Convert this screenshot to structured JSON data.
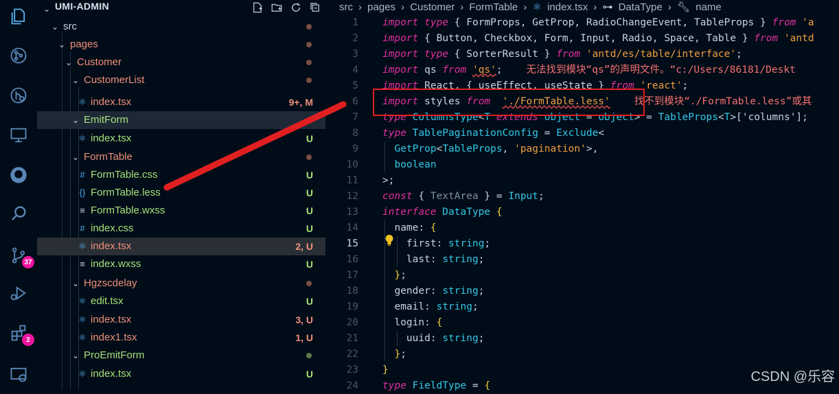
{
  "explorer": {
    "title": "UMI-ADMIN",
    "actions": [
      "new-file-icon",
      "new-folder-icon",
      "refresh-icon",
      "collapse-icon"
    ],
    "items": [
      {
        "label": "src",
        "type": "folder",
        "status": "",
        "color": "#c9d4e3"
      },
      {
        "label": "pages",
        "type": "folder",
        "status": "",
        "color": "#f0907a"
      },
      {
        "label": "Customer",
        "type": "folder",
        "status": "",
        "color": "#f0907a"
      },
      {
        "label": "CustomerList",
        "type": "folder",
        "status": "",
        "color": "#f0907a"
      },
      {
        "label": "index.tsx",
        "type": "react",
        "status": "9+, M",
        "color": "#f0907a"
      },
      {
        "label": "EmitForm",
        "type": "folder",
        "status": "",
        "color": "#a6e07a"
      },
      {
        "label": "index.tsx",
        "type": "react",
        "status": "U",
        "color": "#a6e07a"
      },
      {
        "label": "FormTable",
        "type": "folder",
        "status": "",
        "color": "#f0907a"
      },
      {
        "label": "FormTable.css",
        "type": "hash",
        "status": "U",
        "color": "#a6e07a"
      },
      {
        "label": "FormTable.less",
        "type": "braces",
        "status": "U",
        "color": "#a6e07a"
      },
      {
        "label": "FormTable.wxss",
        "type": "lines",
        "status": "U",
        "color": "#a6e07a"
      },
      {
        "label": "index.css",
        "type": "hash",
        "status": "U",
        "color": "#a6e07a"
      },
      {
        "label": "index.tsx",
        "type": "react",
        "status": "2, U",
        "color": "#f0907a"
      },
      {
        "label": "index.wxss",
        "type": "lines",
        "status": "U",
        "color": "#a6e07a"
      },
      {
        "label": "Hgzscdelay",
        "type": "folder",
        "status": "",
        "color": "#f0907a"
      },
      {
        "label": "edit.tsx",
        "type": "react",
        "status": "U",
        "color": "#a6e07a"
      },
      {
        "label": "index.tsx",
        "type": "react",
        "status": "3, U",
        "color": "#f0907a"
      },
      {
        "label": "index1.tsx",
        "type": "react",
        "status": "1, U",
        "color": "#f0907a"
      },
      {
        "label": "ProEmitForm",
        "type": "folder",
        "status": "",
        "color": "#a6e07a"
      },
      {
        "label": "index.tsx",
        "type": "react",
        "status": "U",
        "color": "#a6e07a"
      }
    ]
  },
  "activity_bar": {
    "icons": [
      "files-icon",
      "source-control-graph-icon",
      "git-history-icon",
      "remote-explorer-icon",
      "github-icon",
      "search-icon",
      "source-control-icon",
      "run-debug-icon",
      "extensions-icon",
      "remote-icon"
    ],
    "badges": {
      "source_control": "37",
      "extensions": "2"
    }
  },
  "breadcrumb": [
    "src",
    "pages",
    "Customer",
    "FormTable",
    "index.tsx",
    "DataType",
    "name"
  ],
  "editor": {
    "active_line": "15",
    "line_numbers": [
      "1",
      "2",
      "3",
      "4",
      "5",
      "6",
      "7",
      "8",
      "9",
      "10",
      "11",
      "12",
      "13",
      "14",
      "15",
      "16",
      "17",
      "18",
      "19",
      "20",
      "21",
      "22",
      "23",
      "24"
    ],
    "lines": [
      [
        [
          "kw",
          "import"
        ],
        [
          "id",
          " "
        ],
        [
          "kw",
          "type"
        ],
        [
          "pun",
          " { "
        ],
        [
          "id",
          "FormProps, GetProp, RadioChangeEvent, TableProps"
        ],
        [
          "pun",
          " } "
        ],
        [
          "kw",
          "from"
        ],
        [
          "str",
          " 'a"
        ]
      ],
      [
        [
          "kw",
          "import"
        ],
        [
          "pun",
          " { "
        ],
        [
          "id",
          "Button, Checkbox, Form, Input, Radio, Space, Table"
        ],
        [
          "pun",
          " } "
        ],
        [
          "kw",
          "from"
        ],
        [
          "str",
          " 'antd"
        ]
      ],
      [
        [
          "kw",
          "import"
        ],
        [
          "id",
          " "
        ],
        [
          "kw",
          "type"
        ],
        [
          "pun",
          " { "
        ],
        [
          "id",
          "SorterResult"
        ],
        [
          "pun",
          " } "
        ],
        [
          "kw",
          "from"
        ],
        [
          "str",
          " 'antd/es/table/interface'"
        ],
        [
          "pun",
          ";"
        ]
      ],
      [
        [
          "kw",
          "import"
        ],
        [
          "id",
          " qs "
        ],
        [
          "kw",
          "from"
        ],
        [
          "id",
          " "
        ],
        [
          "str",
          "'qs'"
        ],
        [
          "pun",
          ";"
        ],
        [
          "err",
          "    无法找到模块“qs”的声明文件。“c:/Users/86181/Deskt"
        ]
      ],
      [
        [
          "kw",
          "import"
        ],
        [
          "id",
          " React, "
        ],
        [
          "pun",
          "{ "
        ],
        [
          "id",
          "useEffect, useState"
        ],
        [
          "pun",
          " } "
        ],
        [
          "kw",
          "from"
        ],
        [
          "str",
          " 'react'"
        ],
        [
          "pun",
          ";"
        ]
      ],
      [
        [
          "kw",
          "import"
        ],
        [
          "id",
          " styles "
        ],
        [
          "kw",
          "from"
        ],
        [
          "id",
          "  "
        ],
        [
          "str",
          "'./FormTable.less'"
        ],
        [
          "pun",
          "  "
        ],
        [
          "err",
          "  找不到模块“./FormTable.less”或其"
        ]
      ],
      [
        [
          "kw",
          "type"
        ],
        [
          "typ",
          " ColumnsType"
        ],
        [
          "pun",
          "<"
        ],
        [
          "typ",
          "T"
        ],
        [
          "kw",
          " extends"
        ],
        [
          "typ",
          " object"
        ],
        [
          "pun",
          " = "
        ],
        [
          "typ",
          "object"
        ],
        [
          "pun",
          "> = "
        ],
        [
          "typ",
          "TableProps"
        ],
        [
          "pun",
          "<"
        ],
        [
          "typ",
          "T"
        ],
        [
          "pun",
          ">['columns'];"
        ]
      ],
      [
        [
          "kw",
          "type"
        ],
        [
          "typ",
          " TablePaginationConfig"
        ],
        [
          "pun",
          " = "
        ],
        [
          "typ",
          "Exclude"
        ],
        [
          "pun",
          "<"
        ]
      ],
      [
        [
          "id",
          "  "
        ],
        [
          "typ",
          "GetProp"
        ],
        [
          "pun",
          "<"
        ],
        [
          "typ",
          "TableProps"
        ],
        [
          "pun",
          ", "
        ],
        [
          "str",
          "'pagination'"
        ],
        [
          "pun",
          ">,"
        ]
      ],
      [
        [
          "id",
          "  "
        ],
        [
          "typ",
          "boolean"
        ]
      ],
      [
        [
          "pun",
          ">;"
        ]
      ],
      [
        [
          "kw",
          "const"
        ],
        [
          "pun",
          " { "
        ],
        [
          "dim",
          "TextArea"
        ],
        [
          "pun",
          " } = "
        ],
        [
          "typ",
          "Input"
        ],
        [
          "pun",
          ";"
        ]
      ],
      [
        [
          "kw",
          "interface"
        ],
        [
          "typ",
          " DataType"
        ],
        [
          "brk",
          " {"
        ]
      ],
      [
        [
          "id",
          "  "
        ],
        [
          "prop",
          "name"
        ],
        [
          "pun",
          ": "
        ],
        [
          "brk",
          "{"
        ]
      ],
      [
        [
          "id",
          "    "
        ],
        [
          "prop",
          "first"
        ],
        [
          "pun",
          ": "
        ],
        [
          "typ",
          "string"
        ],
        [
          "pun",
          ";"
        ]
      ],
      [
        [
          "id",
          "    "
        ],
        [
          "prop",
          "last"
        ],
        [
          "pun",
          ": "
        ],
        [
          "typ",
          "string"
        ],
        [
          "pun",
          ";"
        ]
      ],
      [
        [
          "id",
          "  "
        ],
        [
          "brk",
          "}"
        ],
        [
          "pun",
          ";"
        ]
      ],
      [
        [
          "id",
          "  "
        ],
        [
          "prop",
          "gender"
        ],
        [
          "pun",
          ": "
        ],
        [
          "typ",
          "string"
        ],
        [
          "pun",
          ";"
        ]
      ],
      [
        [
          "id",
          "  "
        ],
        [
          "prop",
          "email"
        ],
        [
          "pun",
          ": "
        ],
        [
          "typ",
          "string"
        ],
        [
          "pun",
          ";"
        ]
      ],
      [
        [
          "id",
          "  "
        ],
        [
          "prop",
          "login"
        ],
        [
          "pun",
          ": "
        ],
        [
          "brk",
          "{"
        ]
      ],
      [
        [
          "id",
          "    "
        ],
        [
          "prop",
          "uuid"
        ],
        [
          "pun",
          ": "
        ],
        [
          "typ",
          "string"
        ],
        [
          "pun",
          ";"
        ]
      ],
      [
        [
          "id",
          "  "
        ],
        [
          "brk",
          "}"
        ],
        [
          "pun",
          ";"
        ]
      ],
      [
        [
          "brk",
          "}"
        ]
      ],
      [
        [
          "kw",
          "type"
        ],
        [
          "typ",
          " FieldType"
        ],
        [
          "pun",
          " = "
        ],
        [
          "brk",
          "{"
        ]
      ]
    ]
  },
  "watermark": "CSDN @乐容",
  "colors": {
    "annotation_red": "#e02020",
    "keyword": "#e030a0",
    "type": "#33c8e8",
    "string": "#f0a040",
    "untracked": "#a6e07a",
    "modified": "#f0907a"
  }
}
